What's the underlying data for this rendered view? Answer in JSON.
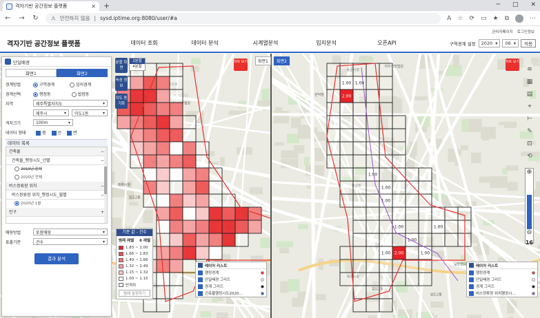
{
  "browser": {
    "tab_title": "격자기반 공간정보 플랫폼",
    "security_label": "안전하지 않음",
    "url": "sysd.iptime.org:8080/user/#a"
  },
  "topmini": {
    "admin": "관리자페이지",
    "logout": "로그인정보"
  },
  "app": {
    "title": "격자기반 공간정보 플랫폼",
    "menus": [
      "데이터 조회",
      "데이터 분석",
      "시계열분석",
      "입지분석",
      "오픈API"
    ],
    "period_label": "구역경계 설정",
    "year": "2020",
    "month": "06",
    "apply_label": "적용"
  },
  "panel": {
    "title": "단일배경",
    "tabs": [
      "화면1",
      "화면2"
    ],
    "boundary_label": "경계방법",
    "boundary_opt1": "구역경계",
    "boundary_opt2": "임의경계",
    "boundary_select_label": "경계선택",
    "boundary_sel1": "행정동",
    "boundary_sel2": "법정동",
    "region_label": "지역",
    "region_value": "제주특별자치도",
    "city_value": "제주시",
    "dong_value": "이도1동",
    "grid_label": "격자크기",
    "grid_value": "100m",
    "datatype_label": "데이터 형태",
    "datatype_points": "점",
    "datatype_lines": "선",
    "datatype_faces": "면",
    "data_list_header": "데이터 목록",
    "groups": [
      {
        "name": "건축물",
        "children": [
          {
            "name": "건축물_행정시도_년별",
            "sub": true
          },
          {
            "name": "2019년 전체",
            "strike": true
          },
          {
            "name": "2020년 전체"
          }
        ]
      },
      {
        "name": "버스정류장 위치",
        "children": [
          {
            "name": "버스정류장 위치_행정시도_월별",
            "sub": true
          },
          {
            "name": "2020년 1월"
          }
        ]
      },
      {
        "name": "인구",
        "children": []
      }
    ],
    "method_label": "매핑방법",
    "method_value": "포함매핑",
    "display_label": "표출기준",
    "display_value": "건수",
    "analyze_label": "결과 분석"
  },
  "map_left": {
    "screen_label": "화면1",
    "view_buttons": [
      "분할 화면",
      "속성 정보",
      "지도 동기화"
    ],
    "mini_tabs": [
      "2분할",
      "4분할"
    ],
    "chart_btn": "차트 보기",
    "legend": {
      "header": "기준 값 - 건수",
      "sub_left": "범례 레벨",
      "sub_right": "6 레벨",
      "items": [
        {
          "label": "1.83 ~ 2.00",
          "color": "#e82226"
        },
        {
          "label": "1.66 ~ 1.83",
          "color": "#ee4b4b"
        },
        {
          "label": "1.49 ~ 1.66",
          "color": "#f27474"
        },
        {
          "label": "1.32 ~ 1.49",
          "color": "#f69c9c"
        },
        {
          "label": "1.15 ~ 1.32",
          "color": "#fbc6c6"
        },
        {
          "label": "1.00 ~ 1.15",
          "color": "#ffffff"
        },
        {
          "label": "빈격자",
          "color": "#f0f0f0"
        }
      ],
      "edit_label": "범례 설정하기"
    },
    "layers_title": "레이어 리스트",
    "layers": [
      {
        "name": "행정경계",
        "color": "#e8302c"
      },
      {
        "name": "단일배경 그리드",
        "color": "#f0f0f0"
      },
      {
        "name": "경계 그리드",
        "color": "#111111"
      },
      {
        "name": "건축물행정시도2020...",
        "color": "#2f63c0"
      }
    ]
  },
  "map_right": {
    "screen_label": "화면2",
    "chart_btn": "차트 보기",
    "cell_values": [
      "1.00",
      "1.00",
      "2.00",
      "1.00",
      "1.00",
      "1.00",
      "1.00",
      "1.00",
      "2.00",
      "1.00",
      "1.00",
      "1.00"
    ],
    "layers_title": "레이어 리스트",
    "layers": [
      {
        "name": "행정경계",
        "color": "#e8302c"
      },
      {
        "name": "단일배경 그리드",
        "color": "#f0f0f0"
      },
      {
        "name": "경계 그리드",
        "color": "#111111"
      },
      {
        "name": "버스정류장 위치행정시...",
        "color": "#9b4fd0"
      }
    ],
    "zoom_level": "16"
  },
  "map_labels": [
    "일도2동",
    "삼도2동",
    "제주시청",
    "남문로터리",
    "동문시장",
    "관덕정",
    "중앙로",
    "KB국민은행",
    "제주지방법원"
  ]
}
